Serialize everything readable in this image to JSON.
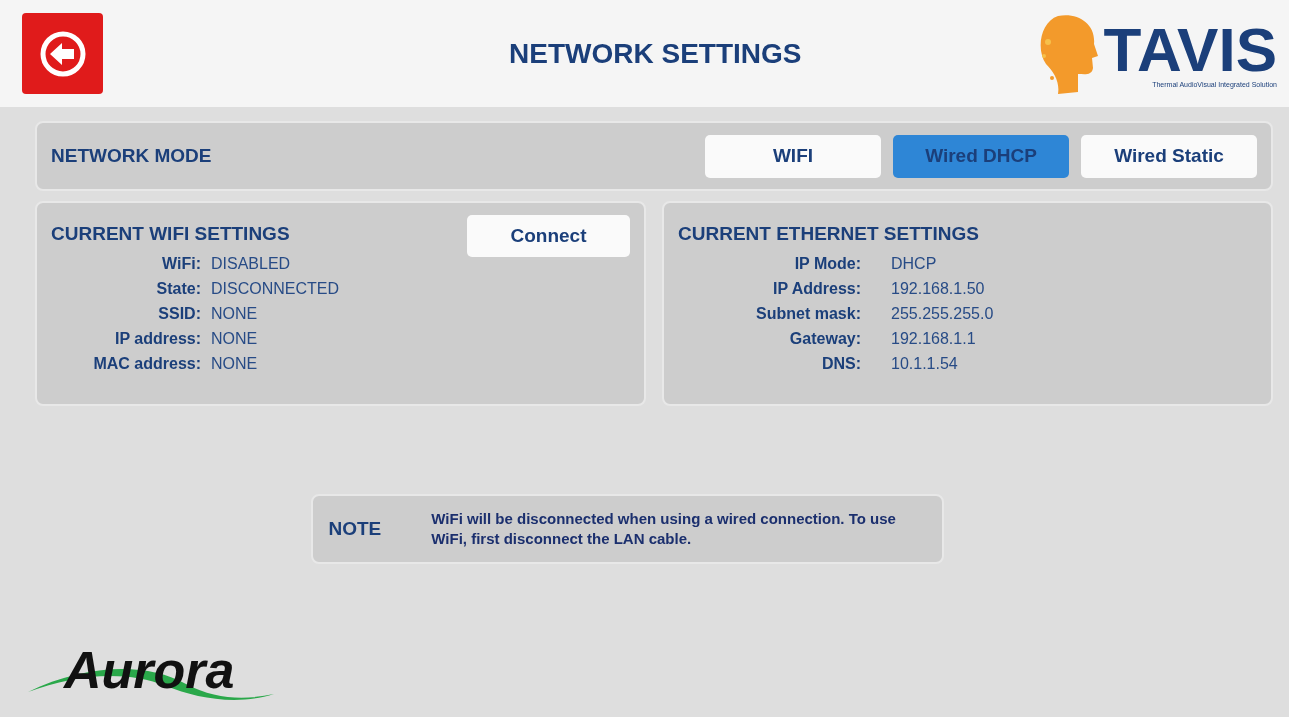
{
  "header": {
    "title": "NETWORK SETTINGS",
    "brand": {
      "name": "TAVIS",
      "tagline": "Thermal AudioVisual Integrated Solution"
    }
  },
  "network_mode": {
    "label": "NETWORK MODE",
    "options": [
      {
        "label": "WIFI",
        "selected": false
      },
      {
        "label": "Wired DHCP",
        "selected": true
      },
      {
        "label": "Wired Static",
        "selected": false
      }
    ]
  },
  "wifi": {
    "title": "CURRENT WIFI SETTINGS",
    "button": "Connect",
    "fields": [
      {
        "label": "WiFi:",
        "value": "DISABLED"
      },
      {
        "label": "State:",
        "value": "DISCONNECTED"
      },
      {
        "label": "SSID:",
        "value": "NONE"
      },
      {
        "label": "IP address:",
        "value": "NONE"
      },
      {
        "label": "MAC address:",
        "value": "NONE"
      }
    ]
  },
  "ethernet": {
    "title": "CURRENT ETHERNET SETTINGS",
    "fields": [
      {
        "label": "IP Mode:",
        "value": "DHCP"
      },
      {
        "label": "IP Address:",
        "value": "192.168.1.50"
      },
      {
        "label": "Subnet mask:",
        "value": "255.255.255.0"
      },
      {
        "label": "Gateway:",
        "value": "192.168.1.1"
      },
      {
        "label": "DNS:",
        "value": "10.1.1.54"
      }
    ]
  },
  "note": {
    "label": "NOTE",
    "text": "WiFi will be disconnected when using a wired connection.  To use WiFi, first disconnect the LAN cable."
  },
  "footer": {
    "logo": "Aurora"
  }
}
